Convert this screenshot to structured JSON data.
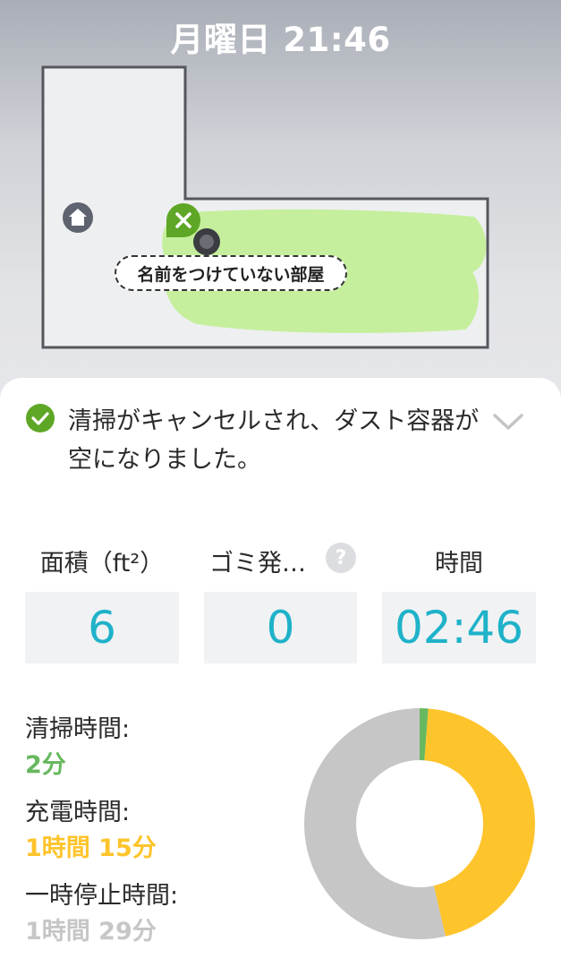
{
  "status_bar": {
    "datetime": "月曜日 21:46"
  },
  "map": {
    "room_label": "名前をつけていない部屋",
    "colors": {
      "cleaned_area": "#c5ef9c",
      "walls": "#55575d",
      "floor": "#eeeff1",
      "marker": "#5ea726"
    },
    "icons": {
      "dock": "home-icon",
      "end_marker": "close-icon",
      "robot": "robot-icon"
    }
  },
  "summary": {
    "message": "清掃がキャンセルされ、ダスト容器が空になりました。",
    "status_icon": "check-circle-icon",
    "expand_icon": "chevron-down-icon"
  },
  "stats": {
    "area": {
      "label": "面積（ft²）",
      "value": "6"
    },
    "dirt": {
      "label": "ゴミ発…",
      "value": "0",
      "help_icon": "?"
    },
    "time": {
      "label": "時間",
      "value": "02:46"
    },
    "value_color": "#1fb2c9"
  },
  "breakdown": {
    "cleaning": {
      "label": "清掃時間:",
      "value": "2分",
      "color": "#67b85e"
    },
    "charging": {
      "label": "充電時間:",
      "value": "1時間 15分",
      "color": "#fec42b"
    },
    "paused": {
      "label": "一時停止時間:",
      "value": "1時間 29分",
      "color": "#c6c6c6"
    }
  },
  "chart_data": {
    "type": "pie",
    "categories": [
      "清掃時間",
      "充電時間",
      "一時停止時間"
    ],
    "values": [
      2,
      75,
      89
    ],
    "colors": [
      "#67b85e",
      "#fec42b",
      "#c6c6c6"
    ],
    "units": "分"
  }
}
